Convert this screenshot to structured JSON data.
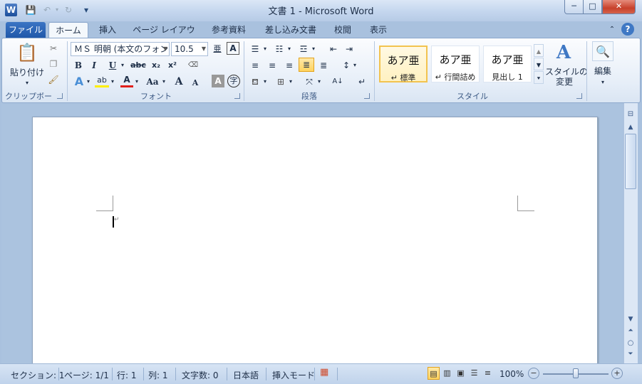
{
  "title": "文書 1 - Microsoft Word",
  "quick_access": {
    "app_icon": "W",
    "save_icon": "💾",
    "undo_icon": "↶",
    "redo_icon": "↻",
    "customize_icon": "▾"
  },
  "window_buttons": {
    "minimize": "─",
    "maximize": "□",
    "close": "✕"
  },
  "tabs": {
    "file": "ファイル",
    "home": "ホーム",
    "insert": "挿入",
    "page_layout": "ページ レイアウト",
    "references": "参考資料",
    "mailings": "差し込み文書",
    "review": "校閲",
    "view": "表示"
  },
  "ribbon": {
    "clipboard": {
      "label": "クリップボード",
      "paste": "貼り付け"
    },
    "font": {
      "label": "フォント",
      "font_name": "ＭＳ 明朝 (本文のフォン",
      "font_size": "10.5",
      "bold": "B",
      "italic": "I",
      "underline": "U",
      "strike": "abc",
      "subscript": "x₂",
      "superscript": "x²",
      "change_case": "Aa",
      "grow": "A",
      "shrink": "A"
    },
    "paragraph": {
      "label": "段落"
    },
    "styles": {
      "label": "スタイル",
      "items": [
        {
          "sample": "あア亜",
          "name": "↵ 標準"
        },
        {
          "sample": "あア亜",
          "name": "↵ 行間詰め"
        },
        {
          "sample": "あア亜",
          "name": "見出し 1"
        }
      ],
      "change_styles": "スタイルの\n変更"
    },
    "editing": {
      "label": "編集"
    }
  },
  "status": {
    "section": "セクション: 1",
    "page": "ページ: 1/1",
    "line": "行: 1",
    "column": "列: 1",
    "word_count": "文字数: 0",
    "language": "日本語",
    "insert_mode": "挿入モード",
    "zoom": "100%"
  }
}
